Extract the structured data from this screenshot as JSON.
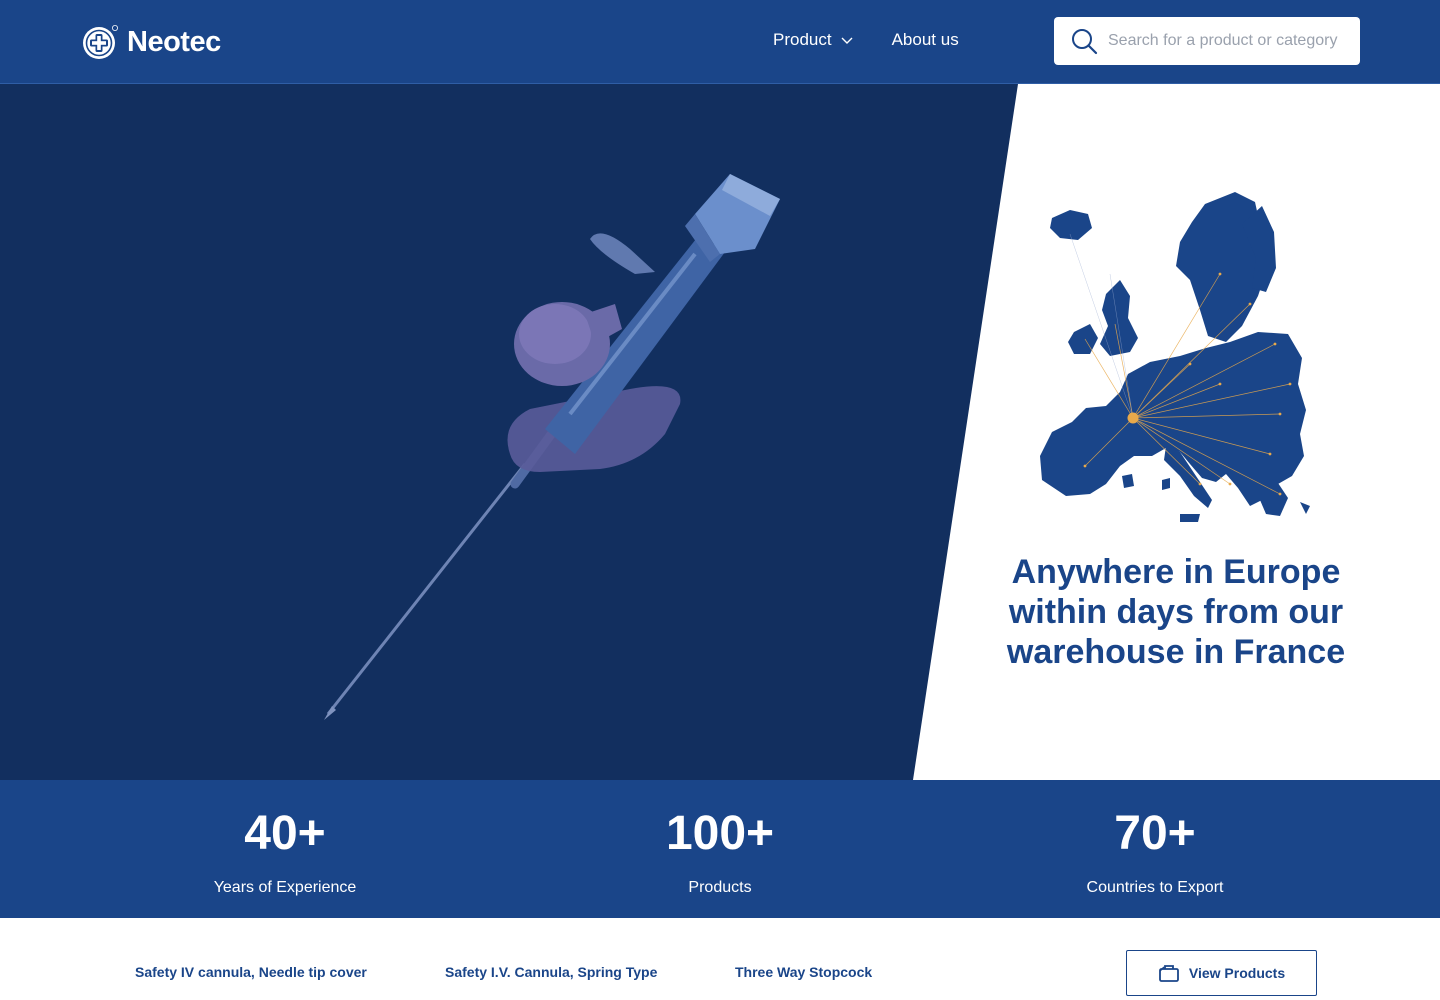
{
  "header": {
    "brand": "Neotec",
    "nav": [
      {
        "label": "Product",
        "has_dropdown": true
      },
      {
        "label": "About us",
        "has_dropdown": false
      }
    ],
    "search": {
      "placeholder": "Search for a product or category",
      "value": ""
    }
  },
  "hero": {
    "image_icon": "iv-cannula-image",
    "map_icon": "europe-map",
    "title": "Anywhere in Europe within days from our warehouse in France"
  },
  "stats": [
    {
      "value": "40+",
      "label": "Years of Experience"
    },
    {
      "value": "100+",
      "label": "Products"
    },
    {
      "value": "70+",
      "label": "Countries to Export"
    }
  ],
  "products": {
    "links": [
      "Safety IV cannula, Needle tip cover",
      "Safety I.V. Cannula, Spring Type",
      "Three Way Stopcock"
    ],
    "view_button": "View Products"
  },
  "colors": {
    "primary": "#1a4589",
    "hero_dark": "#122f5f",
    "map_accent": "#e8a94b"
  }
}
